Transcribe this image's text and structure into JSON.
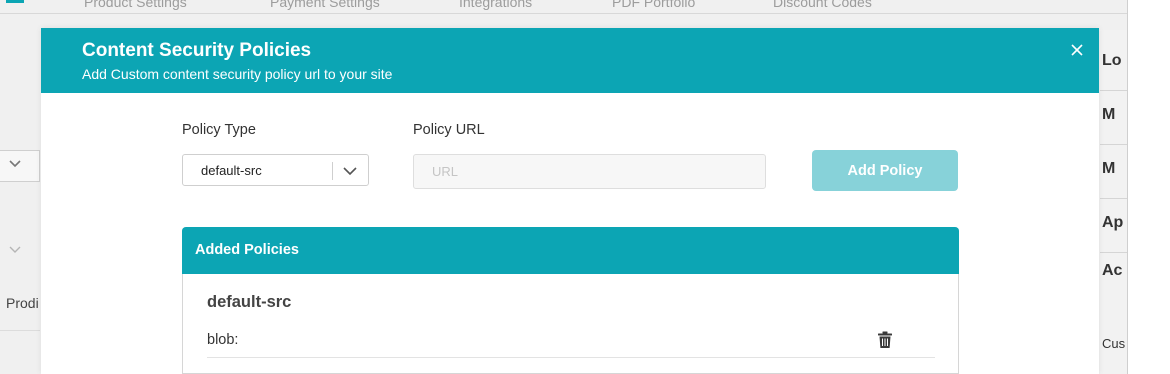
{
  "background": {
    "tabs": [
      "Product Settings",
      "Payment Settings",
      "Integrations",
      "PDF Portfolio",
      "Discount Codes"
    ],
    "left_text": "Prodi",
    "right_items": [
      "Lo",
      "M",
      "M",
      "Ap",
      "Ac"
    ],
    "right_small": "Cus"
  },
  "modal": {
    "title": "Content Security Policies",
    "subtitle": "Add Custom content security policy url to your site",
    "close_icon": "close-icon",
    "form": {
      "policy_type_label": "Policy Type",
      "policy_type_value": "default-src",
      "policy_url_label": "Policy URL",
      "policy_url_placeholder": "URL",
      "policy_url_value": "",
      "add_button": "Add Policy"
    },
    "added_policies": {
      "title": "Added Policies",
      "groups": [
        {
          "type": "default-src",
          "urls": [
            "blob:"
          ]
        }
      ]
    }
  },
  "colors": {
    "accent": "#0ca5b4",
    "button_disabled": "#87d2d9"
  }
}
